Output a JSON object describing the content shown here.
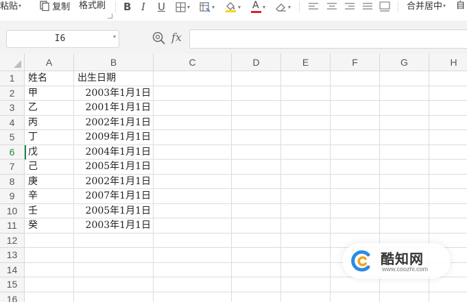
{
  "toolbar": {
    "paste_label": "粘贴",
    "copy_label": "复制",
    "format_painter_label": "格式刷",
    "bold_label": "B",
    "italic_label": "I",
    "underline_label": "U",
    "font_color_label": "A",
    "merge_center_label": "合并居中",
    "auto_wrap_label": "自"
  },
  "formula_bar": {
    "cell_ref": "I6",
    "fx_label": "fx",
    "formula": ""
  },
  "sheet": {
    "columns": [
      "A",
      "B",
      "C",
      "D",
      "E",
      "F",
      "G",
      "H"
    ],
    "active_row": 6,
    "rows": [
      {
        "num": "1",
        "a": "姓名",
        "b": "出生日期"
      },
      {
        "num": "2",
        "a": "甲",
        "b": "2003年1月1日"
      },
      {
        "num": "3",
        "a": "乙",
        "b": "2001年1月1日"
      },
      {
        "num": "4",
        "a": "丙",
        "b": "2002年1月1日"
      },
      {
        "num": "5",
        "a": "丁",
        "b": "2009年1月1日"
      },
      {
        "num": "6",
        "a": "戊",
        "b": "2004年1月1日"
      },
      {
        "num": "7",
        "a": "己",
        "b": "2005年1月1日"
      },
      {
        "num": "8",
        "a": "庚",
        "b": "2002年1月1日"
      },
      {
        "num": "9",
        "a": "辛",
        "b": "2007年1月1日"
      },
      {
        "num": "10",
        "a": "壬",
        "b": "2005年1月1日"
      },
      {
        "num": "11",
        "a": "癸",
        "b": "2003年1月1日"
      },
      {
        "num": "12",
        "a": "",
        "b": ""
      },
      {
        "num": "13",
        "a": "",
        "b": ""
      },
      {
        "num": "14",
        "a": "",
        "b": ""
      },
      {
        "num": "15",
        "a": "",
        "b": ""
      },
      {
        "num": "16",
        "a": "",
        "b": ""
      }
    ]
  },
  "watermark": {
    "name": "酷知网",
    "url": "www.coozhi.com"
  },
  "colors": {
    "active_row": "#1a8a3a",
    "font_color_bar": "#e02020",
    "fill_color_bar": "#f5d400",
    "header_bg": "#f5f5f5",
    "formula_bar_bg": "#f3f3f3"
  }
}
